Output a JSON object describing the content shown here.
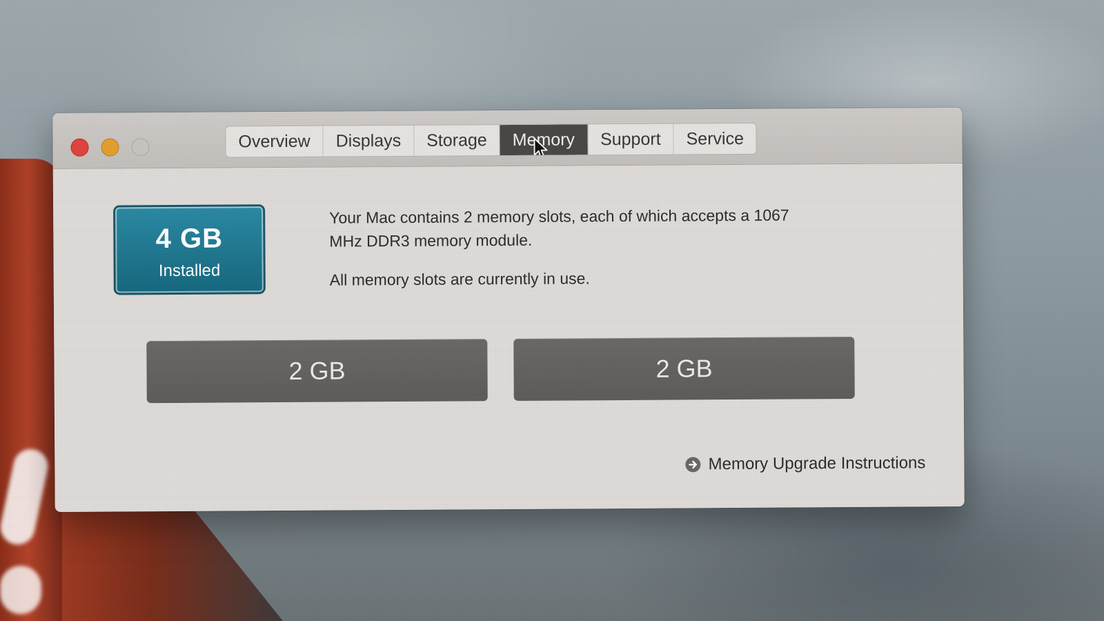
{
  "window": {
    "tabs": [
      {
        "label": "Overview",
        "active": false
      },
      {
        "label": "Displays",
        "active": false
      },
      {
        "label": "Storage",
        "active": false
      },
      {
        "label": "Memory",
        "active": true
      },
      {
        "label": "Support",
        "active": false
      },
      {
        "label": "Service",
        "active": false
      }
    ]
  },
  "memory": {
    "installed_amount": "4 GB",
    "installed_label": "Installed",
    "description_line1": "Your Mac contains 2 memory slots, each of which accepts a 1067 MHz DDR3 memory module.",
    "description_line2": "All memory slots are currently in use.",
    "slots": [
      "2 GB",
      "2 GB"
    ],
    "upgrade_link": "Memory Upgrade Instructions"
  },
  "colors": {
    "close": "#e0443e",
    "minimize": "#e3a02e",
    "zoom_disabled": "#c8c4c1",
    "installed_badge": "#1f7890",
    "slot": "#666462",
    "active_tab": "#4a4846"
  },
  "icons": {
    "pointer": "pointer-cursor-icon",
    "upgrade_link": "arrow-circle-right-icon"
  }
}
